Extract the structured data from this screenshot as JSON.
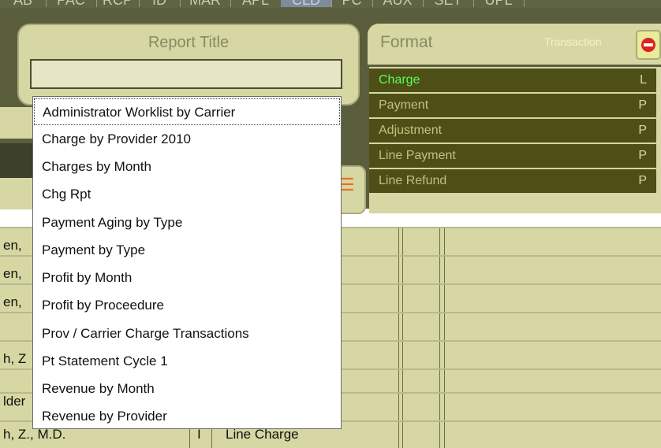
{
  "top_tabs": [
    {
      "label": "AB",
      "active": false
    },
    {
      "label": "PAC",
      "active": false
    },
    {
      "label": "RCP",
      "active": false
    },
    {
      "label": "ID",
      "active": false
    },
    {
      "label": "MAR",
      "active": false
    },
    {
      "label": "APL",
      "active": false
    },
    {
      "label": "CLD",
      "active": true
    },
    {
      "label": "PC",
      "active": false
    },
    {
      "label": "AUX",
      "active": false
    },
    {
      "label": "SET",
      "active": false
    },
    {
      "label": "UPL",
      "active": false
    }
  ],
  "report_title": {
    "label": "Report Title",
    "value": ""
  },
  "format": {
    "label": "Format",
    "transaction_label": "Transaction",
    "rows": [
      {
        "name": "Charge",
        "code": "L",
        "active": true
      },
      {
        "name": "Payment",
        "code": "P",
        "active": false
      },
      {
        "name": "Adjustment",
        "code": "P",
        "active": false
      },
      {
        "name": "Line Payment",
        "code": "P",
        "active": false
      },
      {
        "name": "Line Refund",
        "code": "P",
        "active": false
      }
    ]
  },
  "grid": {
    "rows": [
      "en,",
      "en,",
      "en,",
      "",
      "h, Z",
      "lder",
      "h, Z., M.D."
    ],
    "bottom_mid": "I",
    "bottom_right": "Line Charge"
  },
  "dropdown": {
    "items": [
      "Administrator Worklist by Carrier",
      "Charge by Provider 2010",
      "Charges by Month",
      "Chg Rpt",
      "Payment Aging by Type",
      "Payment by Type",
      "Profit by Month",
      "Profit by Proceedure",
      "Prov / Carrier Charge Transactions",
      "Pt Statement Cycle 1",
      "Revenue by Month",
      "Revenue by Provider"
    ]
  },
  "colors": {
    "panel": "#5a5e3d",
    "light_olive": "#d6d7a2",
    "active_format": "#55ff55"
  },
  "icons": {
    "transaction_button": "no-entry-icon",
    "orange_button": "list-icon"
  }
}
